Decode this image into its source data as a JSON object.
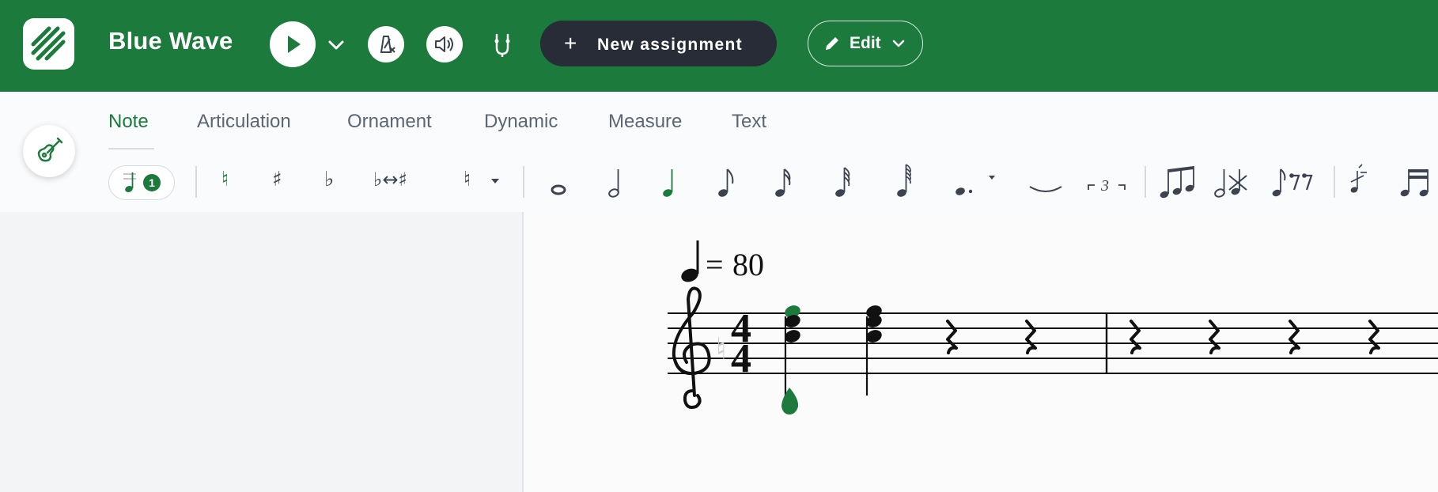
{
  "header": {
    "app_title": "Blue Wave",
    "logo_icon": "stripes-logo-icon",
    "play_icon": "play-icon",
    "playback_menu_icon": "chevron-down-icon",
    "metronome_icon": "metronome-off-icon",
    "sound_icon": "speaker-icon",
    "mic_icon": "microphone-icon",
    "new_assignment_label": "New assignment",
    "edit_label": "Edit",
    "colors": {
      "brand_green": "#1b7a3c",
      "dark_button": "#272c36"
    }
  },
  "tabs": [
    {
      "label": "Note",
      "active": true
    },
    {
      "label": "Articulation",
      "active": false
    },
    {
      "label": "Ornament",
      "active": false
    },
    {
      "label": "Dynamic",
      "active": false
    },
    {
      "label": "Measure",
      "active": false
    },
    {
      "label": "Text",
      "active": false
    }
  ],
  "side_tool_icon": "instrument-guitar-icon",
  "toolbar": {
    "voice_number": "1",
    "tools": [
      "voice-selector",
      "natural",
      "sharp",
      "flat",
      "enharmonic-flip",
      "courtesy-accidental-menu",
      "whole-note",
      "half-note",
      "quarter-note",
      "eighth-note",
      "sixteenth-note",
      "thirty-second-note",
      "sixty-fourth-note",
      "dot-menu",
      "tie",
      "tuplet",
      "beam-group",
      "cross-beam",
      "rest-tools",
      "grace-note",
      "beamed-sixteenths"
    ],
    "selected_duration": "quarter-note",
    "enharmonic_label": "♭↔♯",
    "tuplet_number": "3"
  },
  "score": {
    "tempo_value": "80",
    "tempo_equals": "=",
    "time_signature": {
      "numerator": "4",
      "denominator": "4"
    },
    "clef": "treble",
    "measures": [
      {
        "events": [
          "chord D4-B4-D5 (selected, green)",
          "chord B4-D5-F5",
          "quarter rest",
          "quarter rest"
        ]
      },
      {
        "events": [
          "quarter rest",
          "quarter rest",
          "quarter rest",
          "quarter rest"
        ]
      }
    ],
    "selection_color": "#1b7a3c"
  }
}
